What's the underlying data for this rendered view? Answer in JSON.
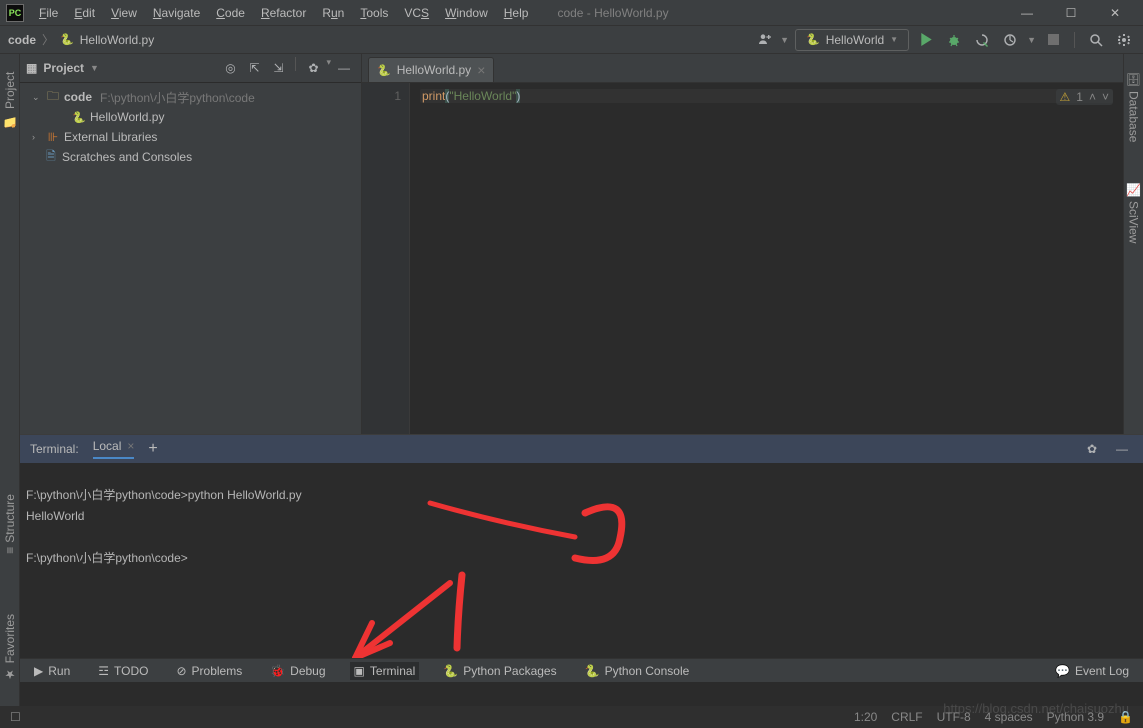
{
  "window": {
    "title": "code - HelloWorld.py"
  },
  "menu": [
    "File",
    "Edit",
    "View",
    "Navigate",
    "Code",
    "Refactor",
    "Run",
    "Tools",
    "VCS",
    "Window",
    "Help"
  ],
  "breadcrumb": {
    "root": "code",
    "file": "HelloWorld.py"
  },
  "runConfig": "HelloWorld",
  "project": {
    "panelTitle": "Project",
    "rootName": "code",
    "rootPath": "F:\\python\\小白学python\\code",
    "file": "HelloWorld.py",
    "ext": "External Libraries",
    "scratch": "Scratches and Consoles"
  },
  "leftGutter": {
    "project": "Project"
  },
  "tab": {
    "name": "HelloWorld.py"
  },
  "editor": {
    "lineNum": "1",
    "fn": "print",
    "open": "(",
    "str": "\"HelloWorld\"",
    "close": ")",
    "warnCount": "1"
  },
  "rightGutter": {
    "db": "Database",
    "sci": "SciView"
  },
  "terminal": {
    "label": "Terminal:",
    "tab": "Local",
    "lines": {
      "l1": "F:\\python\\小白学python\\code>python HelloWorld.py",
      "l2": "HelloWorld",
      "l3": "",
      "l4": "F:\\python\\小白学python\\code>"
    }
  },
  "leftLabels": {
    "structure": "Structure",
    "favorites": "Favorites"
  },
  "bottom": {
    "run": "Run",
    "todo": "TODO",
    "problems": "Problems",
    "debug": "Debug",
    "terminal": "Terminal",
    "pypkg": "Python Packages",
    "pycon": "Python Console",
    "eventLog": "Event Log"
  },
  "status": {
    "pos": "1:20",
    "eol": "CRLF",
    "enc": "UTF-8",
    "indent": "4 spaces",
    "interp": "Python 3.9"
  },
  "watermark": "https://blog.csdn.net/chaisuozhu"
}
